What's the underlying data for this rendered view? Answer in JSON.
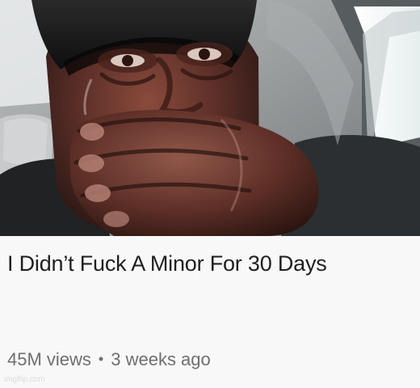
{
  "video": {
    "title": "I Didn’t Fuck A Minor For 30 Days",
    "views": "45M views",
    "separator": "•",
    "age": "3 weeks ago"
  },
  "watermark": {
    "text": "imgflip.com"
  },
  "thumbnail": {
    "subject": "person crying in a car while covering mouth with a hand"
  }
}
